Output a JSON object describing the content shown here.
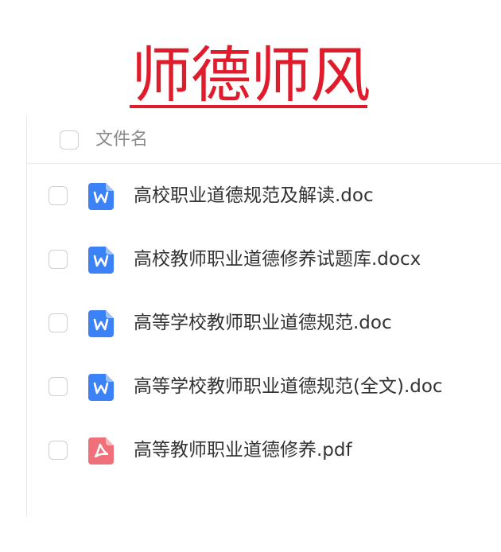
{
  "banner": {
    "title": "师德师风",
    "color": "#e01b2b"
  },
  "list": {
    "header_label": "文件名",
    "files": [
      {
        "name": "高校职业道德规范及解读.doc",
        "icon": "word-doc-icon",
        "color": "#3b82f6"
      },
      {
        "name": "高校教师职业道德修养试题库.docx",
        "icon": "word-doc-icon",
        "color": "#3b82f6"
      },
      {
        "name": "高等学校教师职业道德规范.doc",
        "icon": "word-doc-icon",
        "color": "#3b82f6"
      },
      {
        "name": "高等学校教师职业道德规范(全文).doc",
        "icon": "word-doc-icon",
        "color": "#3b82f6"
      },
      {
        "name": "高等教师职业道德修养.pdf",
        "icon": "pdf-icon",
        "color": "#f0707a"
      }
    ]
  }
}
